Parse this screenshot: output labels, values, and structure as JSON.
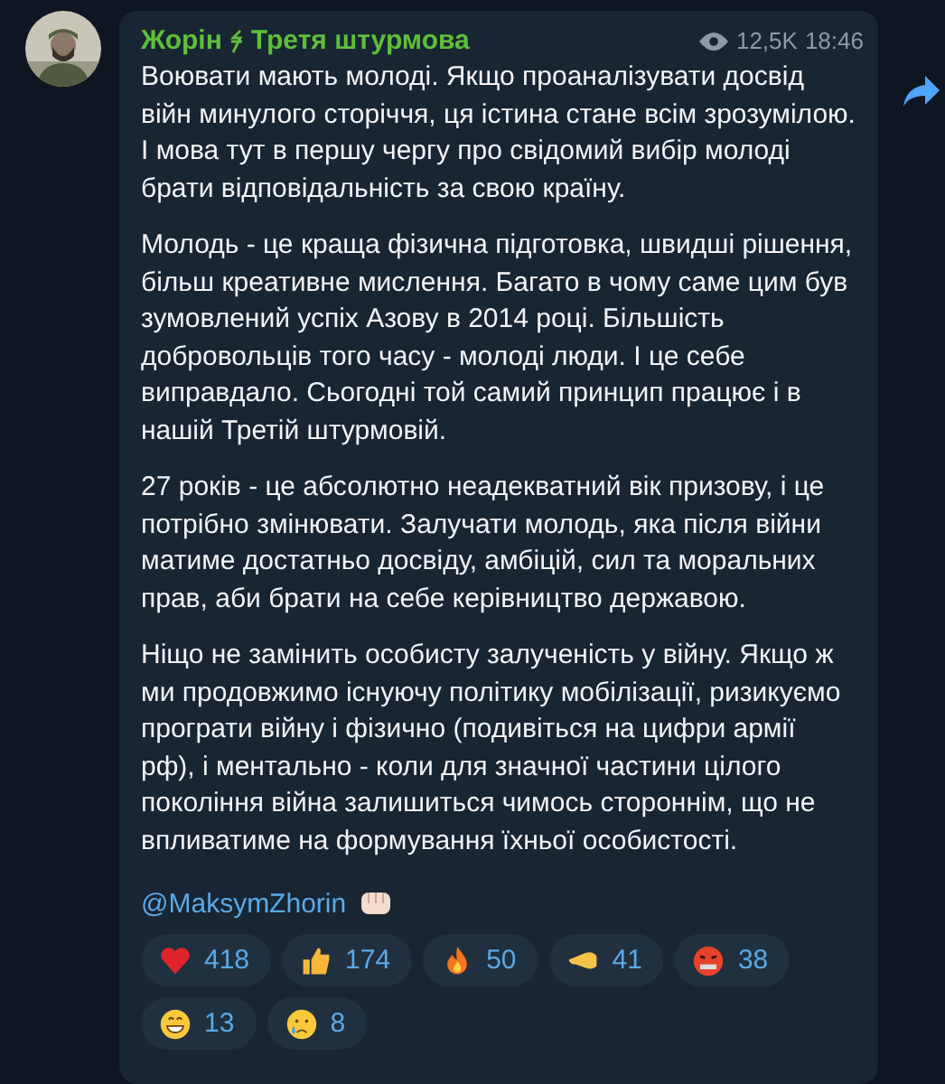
{
  "post": {
    "channel_name": [
      "Жорін",
      "Третя штурмова"
    ],
    "views": "12,5K",
    "time": "18:46",
    "paragraphs": [
      "Воювати мають молоді. Якщо проаналізувати досвід війн минулого сторіччя, ця істина стане всім зрозумілою. І мова тут в першу чергу про свідомий вибір молоді брати відповідальність за свою країну.",
      "Молодь - це краща фізична підготовка, швидші рішення, більш креативне мислення. Багато в чому саме цим був зумовлений успіх Азову в 2014 році. Більшість добровольців того часу - молоді люди. І це себе виправдало. Сьогодні той самий принцип працює і в нашій Третій штурмовій.",
      "27 років - це абсолютно неадекватний вік призову, і це потрібно змінювати. Залучати молодь, яка після війни матиме достатньо досвіду, амбіцій, сил та моральних прав, аби брати на себе керівництво державою.",
      "Ніщо не замінить особисту залученість у війну. Якщо ж ми продовжимо існуючу політику мобілізації, ризикуємо програти війну і фізично (подивіться на цифри армії рф), і ментально - коли для значної частини цілого покоління війна залишиться чимось стороннім, що не впливатиме на формування їхньої особистості."
    ],
    "signature": "@MaksymZhorin",
    "reactions": [
      {
        "kind": "heart",
        "count": "418"
      },
      {
        "kind": "thumbs",
        "count": "174"
      },
      {
        "kind": "fire",
        "count": "50"
      },
      {
        "kind": "point",
        "count": "41"
      },
      {
        "kind": "angry",
        "count": "38"
      },
      {
        "kind": "grin",
        "count": "13"
      },
      {
        "kind": "cry",
        "count": "8"
      }
    ]
  }
}
